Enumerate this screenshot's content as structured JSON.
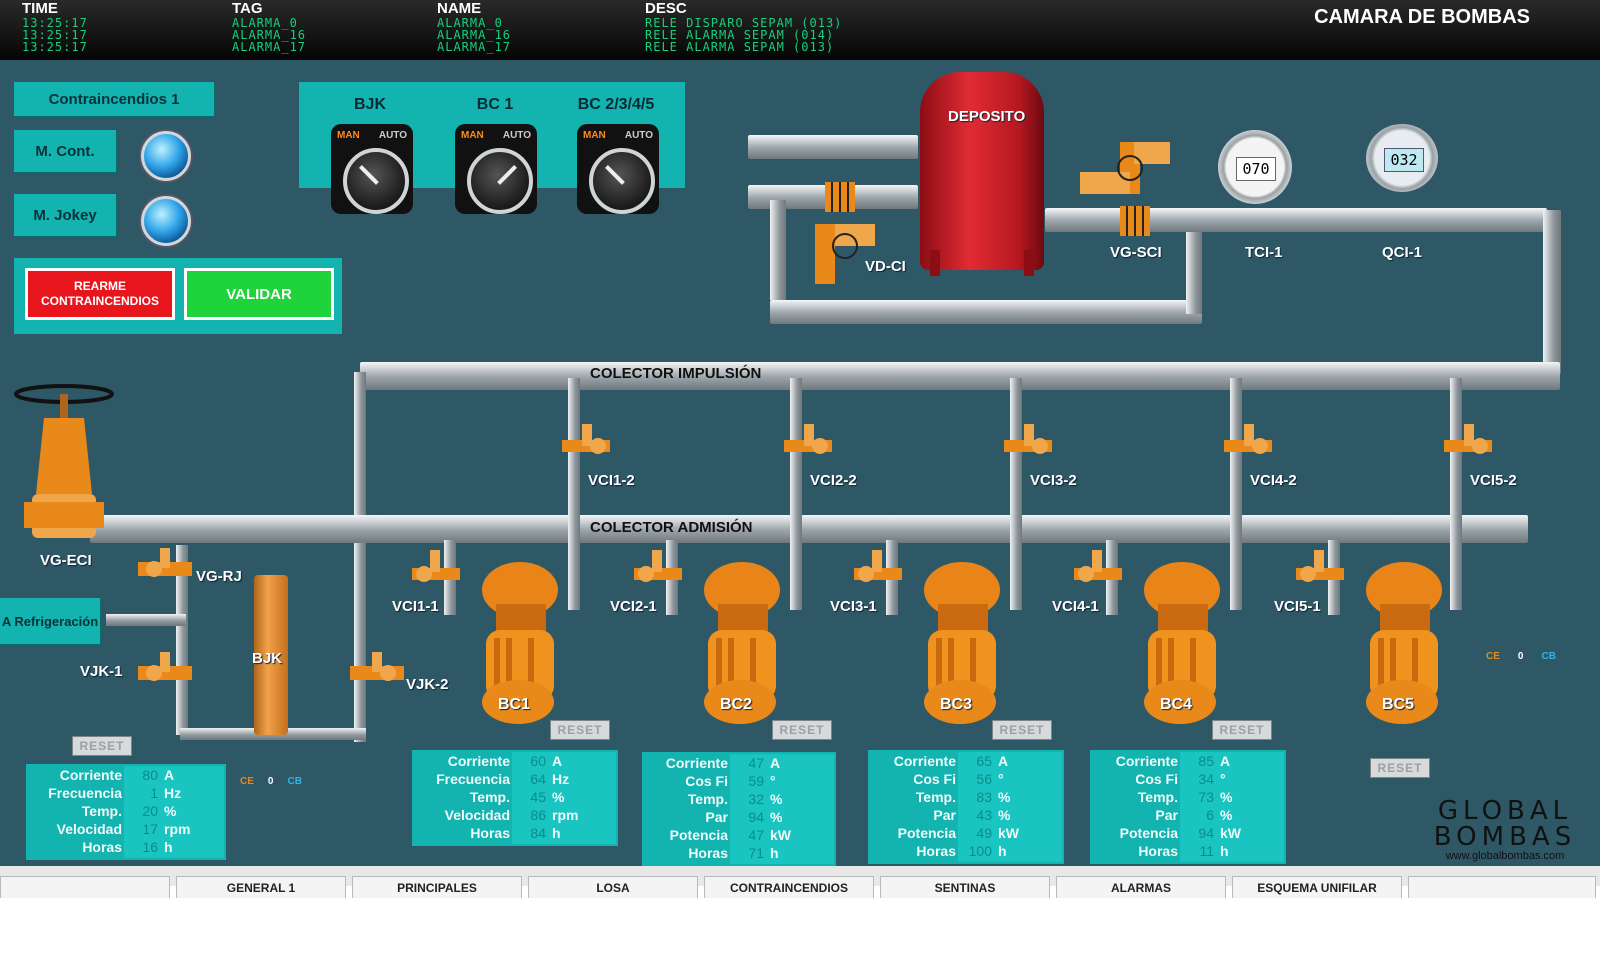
{
  "alarm_bar": {
    "headers": {
      "time": "TIME",
      "tag": "TAG",
      "name": "NAME",
      "desc": "DESC"
    },
    "rows": [
      {
        "time": "13:25:17",
        "tag": "ALARMA_0",
        "name": "ALARMA_0",
        "desc": "RELE DISPARO SEPAM (013)"
      },
      {
        "time": "13:25:17",
        "tag": "ALARMA_16",
        "name": "ALARMA_16",
        "desc": "RELE ALARMA SEPAM (014)"
      },
      {
        "time": "13:25:17",
        "tag": "ALARMA_17",
        "name": "ALARMA_17",
        "desc": "RELE ALARMA SEPAM (013)"
      }
    ]
  },
  "screen_title": "CAMARA DE BOMBAS",
  "controls": {
    "contraincendios": "Contraincendios 1",
    "m_cont": "M. Cont.",
    "m_jokey": "M. Jokey",
    "rearme": "REARME CONTRAINCENDIOS",
    "validar": "VALIDAR",
    "refrigeracion": "A Refrigeración"
  },
  "selectors": [
    {
      "label": "BJK",
      "man": "MAN",
      "auto": "AUTO"
    },
    {
      "label": "BC 1",
      "man": "MAN",
      "auto": "AUTO"
    },
    {
      "label": "BC 2/3/4/5",
      "man": "MAN",
      "auto": "AUTO"
    }
  ],
  "equipment": {
    "deposito": "DEPOSITO",
    "vd_ci": "VD-CI",
    "vg_sci": "VG-SCI",
    "tci": {
      "label": "TCI-1",
      "value": "070"
    },
    "qci": {
      "label": "QCI-1",
      "value": "032"
    },
    "colector_impulsion": "COLECTOR IMPULSIÓN",
    "colector_admision": "COLECTOR ADMISIÓN",
    "vg_eci": "VG-ECI",
    "vg_rj": "VG-RJ",
    "vjk1": "VJK-1",
    "vjk2": "VJK-2",
    "bjk": "BJK"
  },
  "vci2": [
    "VCI1-2",
    "VCI2-2",
    "VCI3-2",
    "VCI4-2",
    "VCI5-2"
  ],
  "vci1": [
    "VCI1-1",
    "VCI2-1",
    "VCI3-1",
    "VCI4-1",
    "VCI5-1"
  ],
  "pumps": [
    "BC1",
    "BC2",
    "BC3",
    "BC4",
    "BC5"
  ],
  "reset_label": "RESET",
  "ce_indicator": {
    "ce": "CE",
    "value": "0",
    "cb": "CB"
  },
  "panels": [
    {
      "name": "bjk",
      "rows": [
        {
          "label": "Corriente",
          "value": "80",
          "unit": "A"
        },
        {
          "label": "Frecuencia",
          "value": "1",
          "unit": "Hz"
        },
        {
          "label": "Temp.",
          "value": "20",
          "unit": "%"
        },
        {
          "label": "Velocidad",
          "value": "17",
          "unit": "rpm"
        },
        {
          "label": "Horas",
          "value": "16",
          "unit": "h"
        }
      ]
    },
    {
      "name": "bc1",
      "rows": [
        {
          "label": "Corriente",
          "value": "60",
          "unit": "A"
        },
        {
          "label": "Frecuencia",
          "value": "64",
          "unit": "Hz"
        },
        {
          "label": "Temp.",
          "value": "45",
          "unit": "%"
        },
        {
          "label": "Velocidad",
          "value": "86",
          "unit": "rpm"
        },
        {
          "label": "Horas",
          "value": "84",
          "unit": "h"
        }
      ]
    },
    {
      "name": "bc2",
      "rows": [
        {
          "label": "Corriente",
          "value": "47",
          "unit": "A"
        },
        {
          "label": "Cos Fi",
          "value": "59",
          "unit": "°"
        },
        {
          "label": "Temp.",
          "value": "32",
          "unit": "%"
        },
        {
          "label": "Par",
          "value": "94",
          "unit": "%"
        },
        {
          "label": "Potencia",
          "value": "47",
          "unit": "kW"
        },
        {
          "label": "Horas",
          "value": "71",
          "unit": "h"
        }
      ]
    },
    {
      "name": "bc3",
      "rows": [
        {
          "label": "Corriente",
          "value": "65",
          "unit": "A"
        },
        {
          "label": "Cos Fi",
          "value": "56",
          "unit": "°"
        },
        {
          "label": "Temp.",
          "value": "83",
          "unit": "%"
        },
        {
          "label": "Par",
          "value": "43",
          "unit": "%"
        },
        {
          "label": "Potencia",
          "value": "49",
          "unit": "kW"
        },
        {
          "label": "Horas",
          "value": "100",
          "unit": "h"
        }
      ]
    },
    {
      "name": "bc4",
      "rows": [
        {
          "label": "Corriente",
          "value": "85",
          "unit": "A"
        },
        {
          "label": "Cos Fi",
          "value": "34",
          "unit": "°"
        },
        {
          "label": "Temp.",
          "value": "73",
          "unit": "%"
        },
        {
          "label": "Par",
          "value": "6",
          "unit": "%"
        },
        {
          "label": "Potencia",
          "value": "94",
          "unit": "kW"
        },
        {
          "label": "Horas",
          "value": "11",
          "unit": "h"
        }
      ]
    }
  ],
  "logo": {
    "line1": "GLOBAL",
    "line2": "BOMBAS",
    "url": "www.globalbombas.com"
  },
  "nav_tabs": [
    "",
    "GENERAL 1",
    "PRINCIPALES",
    "LOSA",
    "CONTRAINCENDIOS",
    "SENTINAS",
    "ALARMAS",
    "ESQUEMA UNIFILAR",
    ""
  ],
  "colors": {
    "background": "#2e5866",
    "panel": "#13b3b0",
    "pump": "#e8891a",
    "tank": "#d4202a",
    "alarm_text": "#16d07a",
    "rearme": "#e8151c",
    "validar": "#1fd43a"
  }
}
